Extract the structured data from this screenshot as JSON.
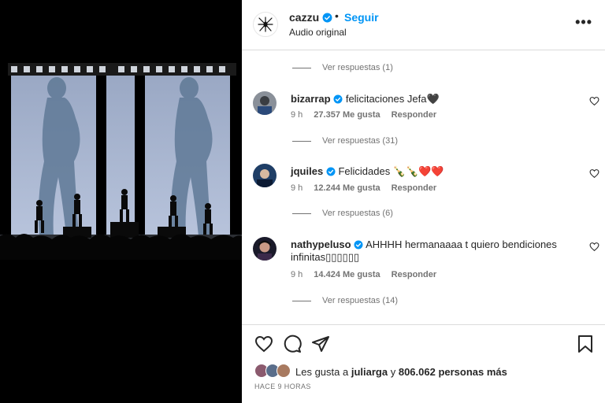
{
  "header": {
    "username": "cazzu",
    "dot": "•",
    "follow_label": "Seguir",
    "subtitle": "Audio original",
    "more_label": "•••"
  },
  "thread": [
    {
      "type": "replies",
      "label": "Ver respuestas (1)"
    },
    {
      "type": "comment",
      "username": "bizarrap",
      "text": "felicitaciones Jefa🖤",
      "time": "9 h",
      "likes": "27.357 Me gusta",
      "reply_label": "Responder"
    },
    {
      "type": "replies",
      "label": "Ver respuestas (31)"
    },
    {
      "type": "comment",
      "username": "jquiles",
      "text": "Felicidades 🍾🍾❤️❤️",
      "time": "9 h",
      "likes": "12.244 Me gusta",
      "reply_label": "Responder"
    },
    {
      "type": "replies",
      "label": "Ver respuestas (6)"
    },
    {
      "type": "comment",
      "username": "nathypeluso",
      "text": "AHHHH hermanaaaa t quiero bendiciones infinitas▯▯▯▯▯▯",
      "time": "9 h",
      "likes": "14.424 Me gusta",
      "reply_label": "Responder"
    },
    {
      "type": "replies",
      "label": "Ver respuestas (14)"
    }
  ],
  "likes": {
    "prefix": "Les gusta a",
    "user": "juliarga",
    "connector": "y",
    "others": "806.062 personas más"
  },
  "timestamp": "HACE 9 HORAS",
  "colors": {
    "accent": "#0095f6",
    "verified": "#0095f6",
    "text": "#262626",
    "muted": "#737373",
    "heart": "#ed1c2e"
  },
  "icons": {
    "like": "heart-outline-icon",
    "comment": "comment-bubble-icon",
    "share": "paper-plane-icon",
    "save": "bookmark-icon",
    "comment_like": "small-heart-icon",
    "verified": "verified-badge-icon",
    "more": "more-options-icon"
  }
}
